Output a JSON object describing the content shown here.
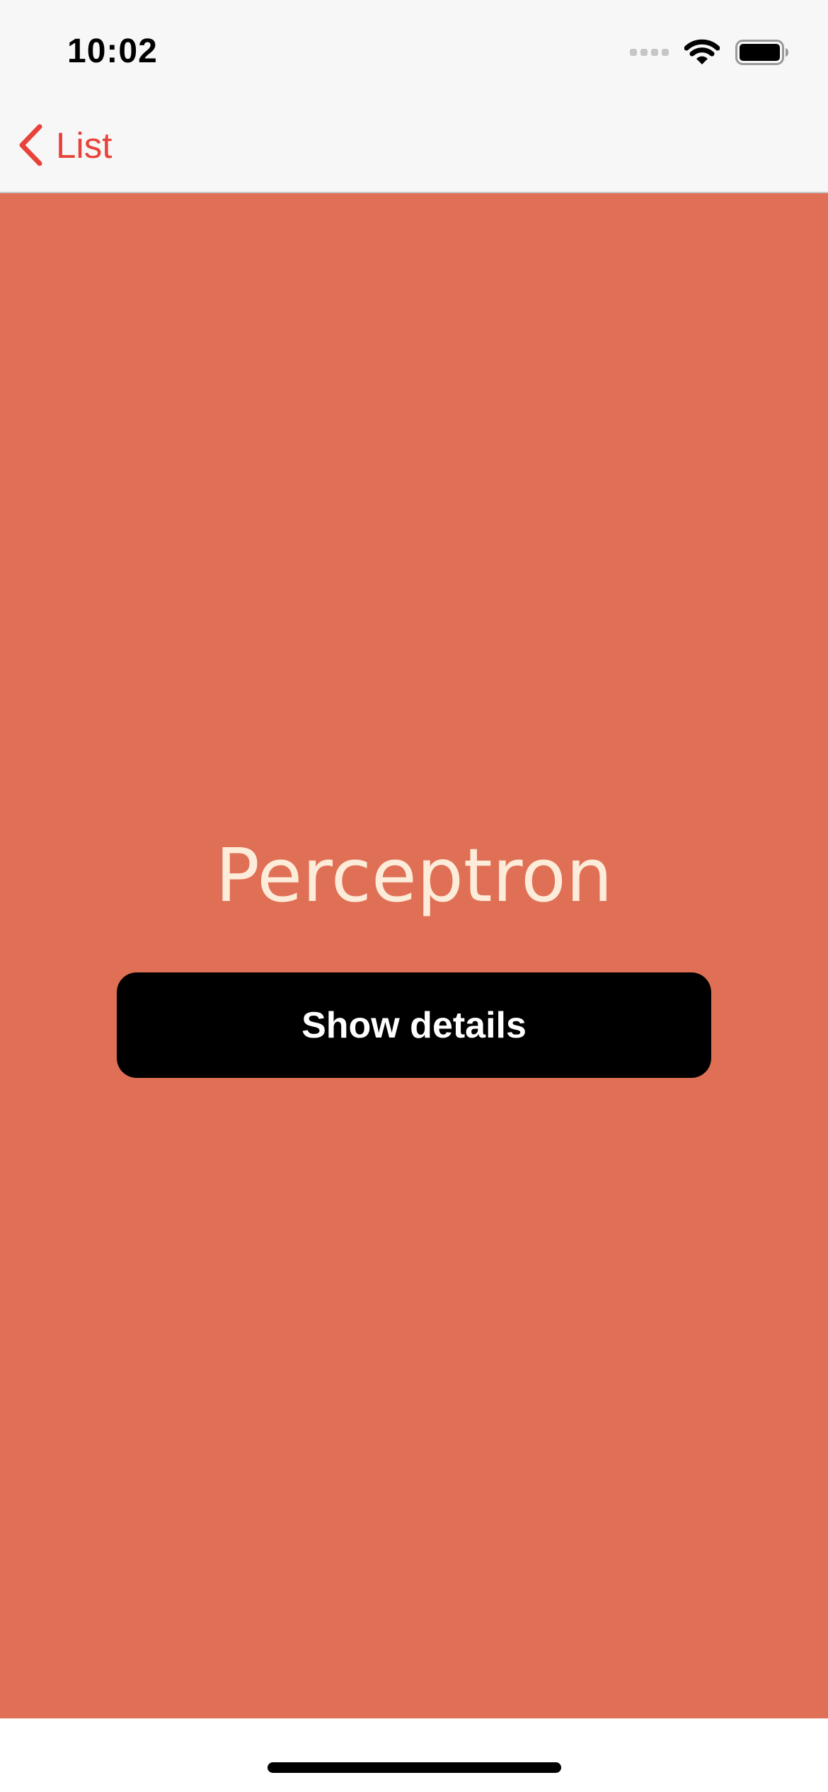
{
  "status_bar": {
    "time": "10:02",
    "icons": [
      "cellular-signal-icon",
      "wifi-icon",
      "battery-icon"
    ]
  },
  "nav": {
    "back_label": "List",
    "back_icon": "chevron-left-icon"
  },
  "main": {
    "title": "Perceptron",
    "button_label": "Show details"
  },
  "colors": {
    "accent": "#e8433a",
    "background": "#e07055",
    "title_text": "#fcecd9",
    "button_bg": "#000000",
    "button_text": "#ffffff",
    "bar_bg": "#f7f7f7"
  }
}
